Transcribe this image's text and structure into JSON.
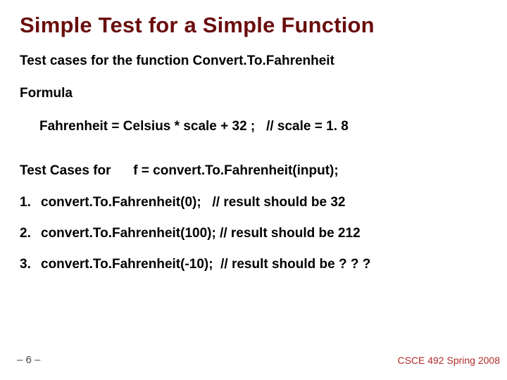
{
  "title": "Simple Test for a Simple Function",
  "subtitle": "Test cases for the  function Convert.To.Fahrenheit",
  "formula_label": "Formula",
  "formula": "Fahrenheit = Celsius * scale + 32 ;   // scale = 1. 8",
  "testcases_label": "Test Cases for      f = convert.To.Fahrenheit(input);",
  "items": [
    {
      "num": "1.",
      "text": "convert.To.Fahrenheit(0);   // result should be 32"
    },
    {
      "num": "2.",
      "text": "convert.To.Fahrenheit(100); // result should be 212"
    },
    {
      "num": "3.",
      "text": "convert.To.Fahrenheit(-10);  // result should be ? ? ?"
    }
  ],
  "footer_left": "– 6 –",
  "footer_right": "CSCE 492 Spring 2008"
}
